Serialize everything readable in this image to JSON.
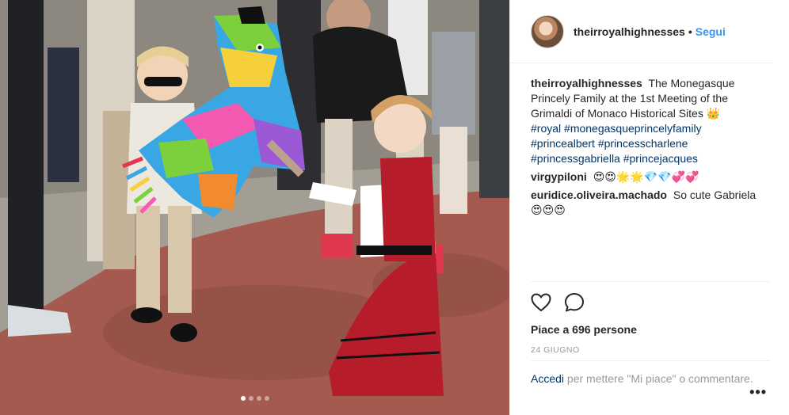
{
  "post": {
    "username": "theirroyalhighnesses",
    "follow_label": "Segui",
    "separator": "•"
  },
  "caption": {
    "username": "theirroyalhighnesses",
    "text": "The Monegasque Princely Family at the 1st Meeting of the Grimaldi of Monaco Historical Sites",
    "emoji": "👑",
    "hashtags": [
      "#royal",
      "#monegasqueprincelyfamily",
      "#princealbert",
      "#princesscharlene",
      "#princessgabriella",
      "#princejacques"
    ]
  },
  "comments": [
    {
      "username": "virgypiloni",
      "text": "😍😍🌟🌟💎💎💞💞"
    },
    {
      "username": "euridice.oliveira.machado",
      "text": "So cute Gabriela 😍😍😍"
    }
  ],
  "likes_text": "Piace a 696 persone",
  "date_text": "24 GIUGNO",
  "login": {
    "link": "Accedi",
    "text": "per mettere \"Mi piace\" o commentare."
  },
  "more_label": "•••",
  "carousel": {
    "count": 4,
    "active": 1
  },
  "colors": {
    "link_blue": "#3897f0",
    "tag_blue": "#003569",
    "muted": "#999999",
    "border": "#efefef"
  },
  "icons": [
    "heart-icon",
    "comment-icon",
    "more-icon"
  ]
}
